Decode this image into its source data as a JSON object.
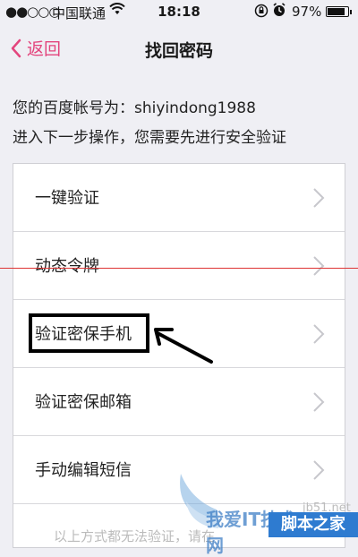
{
  "status_bar": {
    "signal": "●●○○○",
    "carrier": "中国联通",
    "time": "18:18",
    "battery_percent": "97%",
    "battery_level": 0.97
  },
  "nav": {
    "back_label": "返回",
    "title": "找回密码",
    "accent_color": "#e3457d"
  },
  "account": {
    "line": "您的百度帐号为：shiyindong1988",
    "instruction": "进入下一步操作，您需要先进行安全验证"
  },
  "options": [
    {
      "label": "一键验证"
    },
    {
      "label": "动态令牌"
    },
    {
      "label": "验证密保手机"
    },
    {
      "label": "验证密保邮箱"
    },
    {
      "label": "手动编辑短信"
    }
  ],
  "footer_note": "以上方式都无法验证，请在",
  "watermarks": {
    "url": "jb51.net",
    "logo_text": "我爱IT技术网",
    "brand": "脚本之家"
  }
}
